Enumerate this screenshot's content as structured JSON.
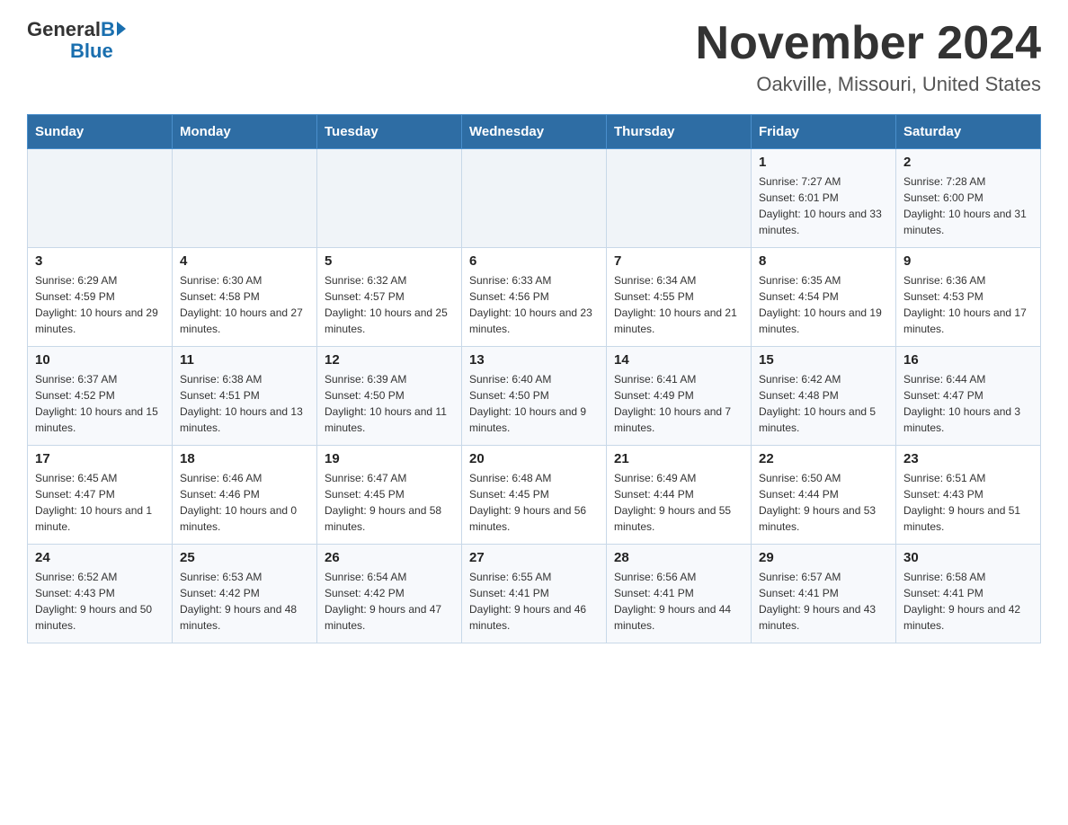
{
  "header": {
    "logo": {
      "general": "General",
      "blue": "Blue"
    },
    "title": "November 2024",
    "subtitle": "Oakville, Missouri, United States"
  },
  "calendar": {
    "weekdays": [
      "Sunday",
      "Monday",
      "Tuesday",
      "Wednesday",
      "Thursday",
      "Friday",
      "Saturday"
    ],
    "weeks": [
      [
        {
          "day": "",
          "info": ""
        },
        {
          "day": "",
          "info": ""
        },
        {
          "day": "",
          "info": ""
        },
        {
          "day": "",
          "info": ""
        },
        {
          "day": "",
          "info": ""
        },
        {
          "day": "1",
          "info": "Sunrise: 7:27 AM\nSunset: 6:01 PM\nDaylight: 10 hours and 33 minutes."
        },
        {
          "day": "2",
          "info": "Sunrise: 7:28 AM\nSunset: 6:00 PM\nDaylight: 10 hours and 31 minutes."
        }
      ],
      [
        {
          "day": "3",
          "info": "Sunrise: 6:29 AM\nSunset: 4:59 PM\nDaylight: 10 hours and 29 minutes."
        },
        {
          "day": "4",
          "info": "Sunrise: 6:30 AM\nSunset: 4:58 PM\nDaylight: 10 hours and 27 minutes."
        },
        {
          "day": "5",
          "info": "Sunrise: 6:32 AM\nSunset: 4:57 PM\nDaylight: 10 hours and 25 minutes."
        },
        {
          "day": "6",
          "info": "Sunrise: 6:33 AM\nSunset: 4:56 PM\nDaylight: 10 hours and 23 minutes."
        },
        {
          "day": "7",
          "info": "Sunrise: 6:34 AM\nSunset: 4:55 PM\nDaylight: 10 hours and 21 minutes."
        },
        {
          "day": "8",
          "info": "Sunrise: 6:35 AM\nSunset: 4:54 PM\nDaylight: 10 hours and 19 minutes."
        },
        {
          "day": "9",
          "info": "Sunrise: 6:36 AM\nSunset: 4:53 PM\nDaylight: 10 hours and 17 minutes."
        }
      ],
      [
        {
          "day": "10",
          "info": "Sunrise: 6:37 AM\nSunset: 4:52 PM\nDaylight: 10 hours and 15 minutes."
        },
        {
          "day": "11",
          "info": "Sunrise: 6:38 AM\nSunset: 4:51 PM\nDaylight: 10 hours and 13 minutes."
        },
        {
          "day": "12",
          "info": "Sunrise: 6:39 AM\nSunset: 4:50 PM\nDaylight: 10 hours and 11 minutes."
        },
        {
          "day": "13",
          "info": "Sunrise: 6:40 AM\nSunset: 4:50 PM\nDaylight: 10 hours and 9 minutes."
        },
        {
          "day": "14",
          "info": "Sunrise: 6:41 AM\nSunset: 4:49 PM\nDaylight: 10 hours and 7 minutes."
        },
        {
          "day": "15",
          "info": "Sunrise: 6:42 AM\nSunset: 4:48 PM\nDaylight: 10 hours and 5 minutes."
        },
        {
          "day": "16",
          "info": "Sunrise: 6:44 AM\nSunset: 4:47 PM\nDaylight: 10 hours and 3 minutes."
        }
      ],
      [
        {
          "day": "17",
          "info": "Sunrise: 6:45 AM\nSunset: 4:47 PM\nDaylight: 10 hours and 1 minute."
        },
        {
          "day": "18",
          "info": "Sunrise: 6:46 AM\nSunset: 4:46 PM\nDaylight: 10 hours and 0 minutes."
        },
        {
          "day": "19",
          "info": "Sunrise: 6:47 AM\nSunset: 4:45 PM\nDaylight: 9 hours and 58 minutes."
        },
        {
          "day": "20",
          "info": "Sunrise: 6:48 AM\nSunset: 4:45 PM\nDaylight: 9 hours and 56 minutes."
        },
        {
          "day": "21",
          "info": "Sunrise: 6:49 AM\nSunset: 4:44 PM\nDaylight: 9 hours and 55 minutes."
        },
        {
          "day": "22",
          "info": "Sunrise: 6:50 AM\nSunset: 4:44 PM\nDaylight: 9 hours and 53 minutes."
        },
        {
          "day": "23",
          "info": "Sunrise: 6:51 AM\nSunset: 4:43 PM\nDaylight: 9 hours and 51 minutes."
        }
      ],
      [
        {
          "day": "24",
          "info": "Sunrise: 6:52 AM\nSunset: 4:43 PM\nDaylight: 9 hours and 50 minutes."
        },
        {
          "day": "25",
          "info": "Sunrise: 6:53 AM\nSunset: 4:42 PM\nDaylight: 9 hours and 48 minutes."
        },
        {
          "day": "26",
          "info": "Sunrise: 6:54 AM\nSunset: 4:42 PM\nDaylight: 9 hours and 47 minutes."
        },
        {
          "day": "27",
          "info": "Sunrise: 6:55 AM\nSunset: 4:41 PM\nDaylight: 9 hours and 46 minutes."
        },
        {
          "day": "28",
          "info": "Sunrise: 6:56 AM\nSunset: 4:41 PM\nDaylight: 9 hours and 44 minutes."
        },
        {
          "day": "29",
          "info": "Sunrise: 6:57 AM\nSunset: 4:41 PM\nDaylight: 9 hours and 43 minutes."
        },
        {
          "day": "30",
          "info": "Sunrise: 6:58 AM\nSunset: 4:41 PM\nDaylight: 9 hours and 42 minutes."
        }
      ]
    ]
  }
}
